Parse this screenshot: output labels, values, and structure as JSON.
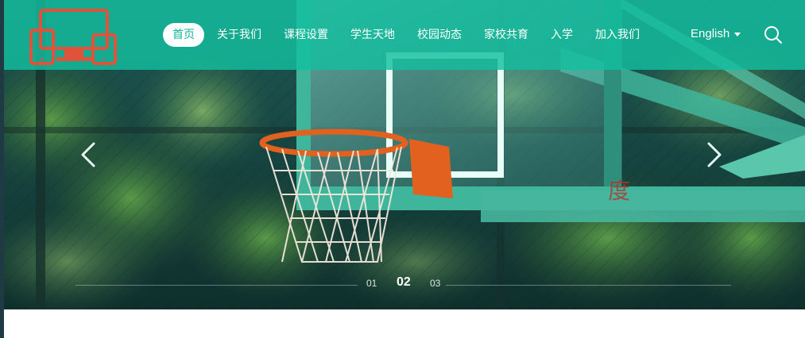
{
  "nav": {
    "items": [
      {
        "label": "首页",
        "active": true
      },
      {
        "label": "关于我们"
      },
      {
        "label": "课程设置"
      },
      {
        "label": "学生天地"
      },
      {
        "label": "校园动态"
      },
      {
        "label": "家校共育"
      },
      {
        "label": "入学"
      },
      {
        "label": "加入我们"
      }
    ]
  },
  "language": {
    "label": "English",
    "icon": "chevron-down-icon"
  },
  "search": {
    "icon": "search-icon"
  },
  "carousel": {
    "pages": [
      "01",
      "02",
      "03"
    ],
    "active_page": "02",
    "prev_icon": "chevron-left-icon",
    "next_icon": "chevron-right-icon"
  },
  "colors": {
    "header_overlay": "#14bea0",
    "logo": "#e0523a",
    "active_nav_text": "#13b59a",
    "backboard_frame": "#3fb59c",
    "rim": "#e2611f"
  }
}
